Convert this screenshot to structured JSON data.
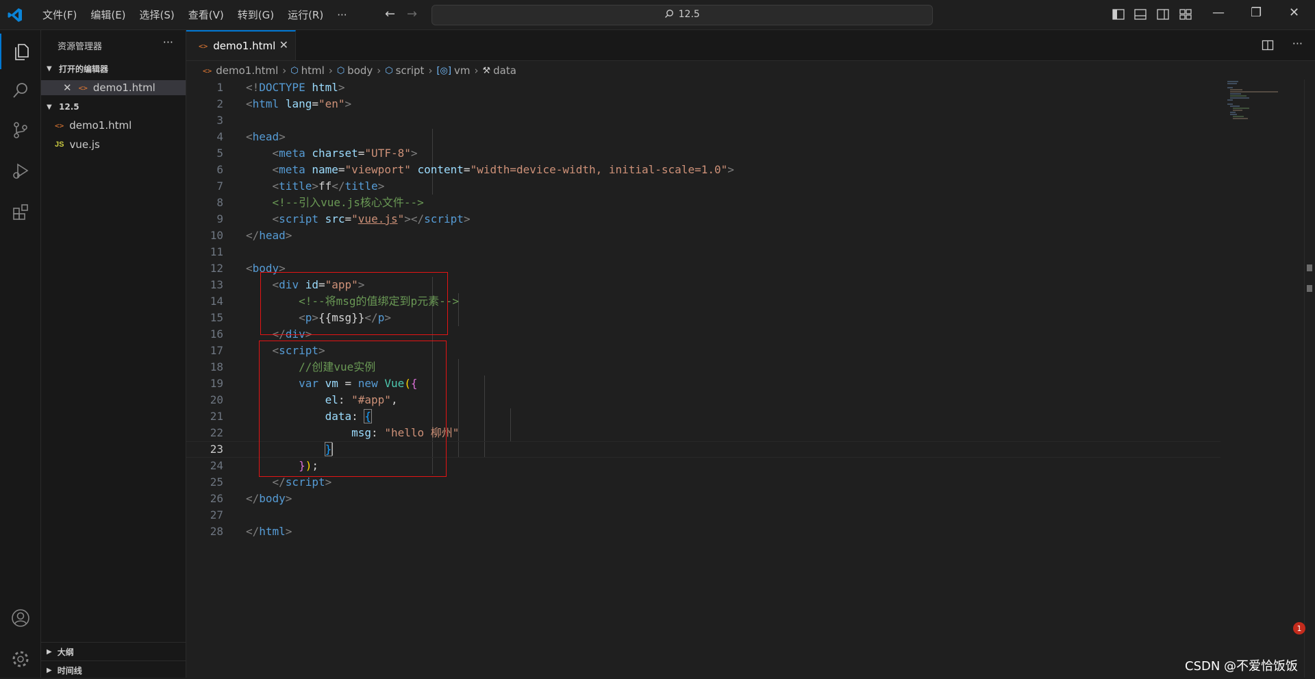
{
  "menu": [
    "文件(F)",
    "编辑(E)",
    "选择(S)",
    "查看(V)",
    "转到(G)",
    "运行(R)"
  ],
  "menu_more": "···",
  "search": {
    "text": "12.5"
  },
  "sidebar": {
    "title": "资源管理器",
    "more": "···",
    "open_editors_header": "打开的编辑器",
    "open_editor_file": "demo1.html",
    "folder_header": "12.5",
    "files": [
      {
        "name": "demo1.html",
        "type": "html"
      },
      {
        "name": "vue.js",
        "type": "js"
      }
    ],
    "outline": "大纲",
    "timeline": "时间线"
  },
  "icons": {
    "html_glyph": "<>",
    "js_glyph": "JS"
  },
  "tab": {
    "label": "demo1.html",
    "close": "✕"
  },
  "breadcrumb": [
    "demo1.html",
    "html",
    "body",
    "script",
    "vm",
    "data"
  ],
  "code": {
    "line_numbers": [
      "1",
      "2",
      "3",
      "4",
      "5",
      "6",
      "7",
      "8",
      "9",
      "10",
      "11",
      "12",
      "13",
      "14",
      "15",
      "16",
      "17",
      "18",
      "19",
      "20",
      "21",
      "22",
      "23",
      "24",
      "25",
      "26",
      "27",
      "28"
    ],
    "current_line": 23
  },
  "watermark": "CSDN @不爱恰饭饭",
  "notification_badge": "1",
  "colors": {
    "accent": "#0078d4",
    "highlight_box": "#e51414"
  }
}
